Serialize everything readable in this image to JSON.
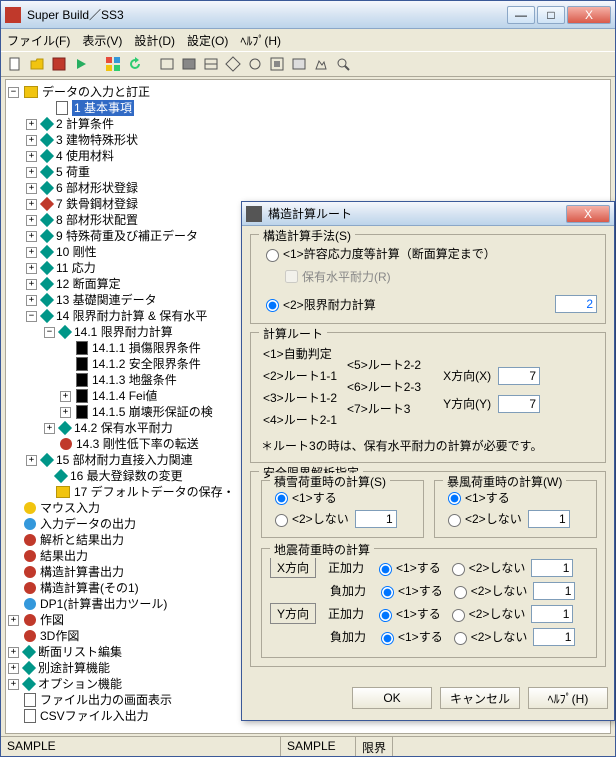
{
  "app": {
    "title": "Super Build／SS3"
  },
  "winbtns": {
    "min": "—",
    "max": "□",
    "close": "X"
  },
  "menu": {
    "file": "ファイル(F)",
    "view": "表示(V)",
    "design": "設計(D)",
    "settings": "設定(O)",
    "help": "ﾍﾙﾌﾟ(H)"
  },
  "tree": {
    "root": "データの入力と訂正",
    "n1": "1 基本事項",
    "n2": "2 計算条件",
    "n3": "3 建物特殊形状",
    "n4": "4 使用材料",
    "n5": "5 荷重",
    "n6": "6 部材形状登録",
    "n7": "7 鉄骨鋼材登録",
    "n8": "8 部材形状配置",
    "n9": "9 特殊荷重及び補正データ",
    "n10": "10 剛性",
    "n11": "11 応力",
    "n12": "12 断面算定",
    "n13": "13 基礎関連データ",
    "n14": "14 限界耐力計算 & 保有水平",
    "n141": "14.1 限界耐力計算",
    "n1411": "14.1.1 損傷限界条件",
    "n1412": "14.1.2 安全限界条件",
    "n1413": "14.1.3 地盤条件",
    "n1414": "14.1.4 Fei値",
    "n1415": "14.1.5 崩壊形保証の検",
    "n142": "14.2 保有水平耐力",
    "n143": "14.3 剛性低下率の転送",
    "n15": "15 部材耐力直接入力関連",
    "n16": "16 最大登録数の変更",
    "n17": "17 デフォルトデータの保存・",
    "mouse": "マウス入力",
    "indata": "入力データの出力",
    "ana": "解析と結果出力",
    "res": "結果出力",
    "scalc": "構造計算書出力",
    "scalc1": "構造計算書(その1)",
    "dp1": "DP1(計算書出力ツール)",
    "p3d": "3D作図",
    "sect": "断面リスト編集",
    "other": "別途計算機能",
    "opt": "オプション機能",
    "scrn": "ファイル出力の画面表示",
    "csv": "CSVファイル入出力",
    "draw": "作図"
  },
  "status": {
    "s1": "SAMPLE",
    "s2": "SAMPLE",
    "s3": "限界"
  },
  "dlg": {
    "title": "構造計算ルート",
    "g1": "構造計算手法(S)",
    "r1": "<1>許容応力度等計算（断面算定まで）",
    "r1a": "保有水平耐力(R)",
    "r2": "<2>限界耐力計算",
    "v2": "2",
    "g2": "計算ルート",
    "rt1": "<1>自動判定",
    "rt2": "<2>ルート1-1",
    "rt3": "<3>ルート1-2",
    "rt4": "<4>ルート2-1",
    "rt5": "<5>ルート2-2",
    "rt6": "<6>ルート2-3",
    "rt7": "<7>ルート3",
    "xdir": "X方向(X)",
    "ydir": "Y方向(Y)",
    "vx": "7",
    "vy": "7",
    "note": "＊ルート3の時は、保有水平耐力の計算が必要です。",
    "g3": "安全限界解析指定",
    "g3a": "積雪荷重時の計算(S)",
    "g3b": "暴風荷重時の計算(W)",
    "do1": "<1>する",
    "do2": "<2>しない",
    "v1": "1",
    "g3c": "地震荷重時の計算",
    "xh": "X方向",
    "yh": "Y方向",
    "pos": "正加力",
    "neg": "負加力",
    "ok": "OK",
    "cancel": "キャンセル",
    "help": "ﾍﾙﾌﾟ(H)"
  }
}
